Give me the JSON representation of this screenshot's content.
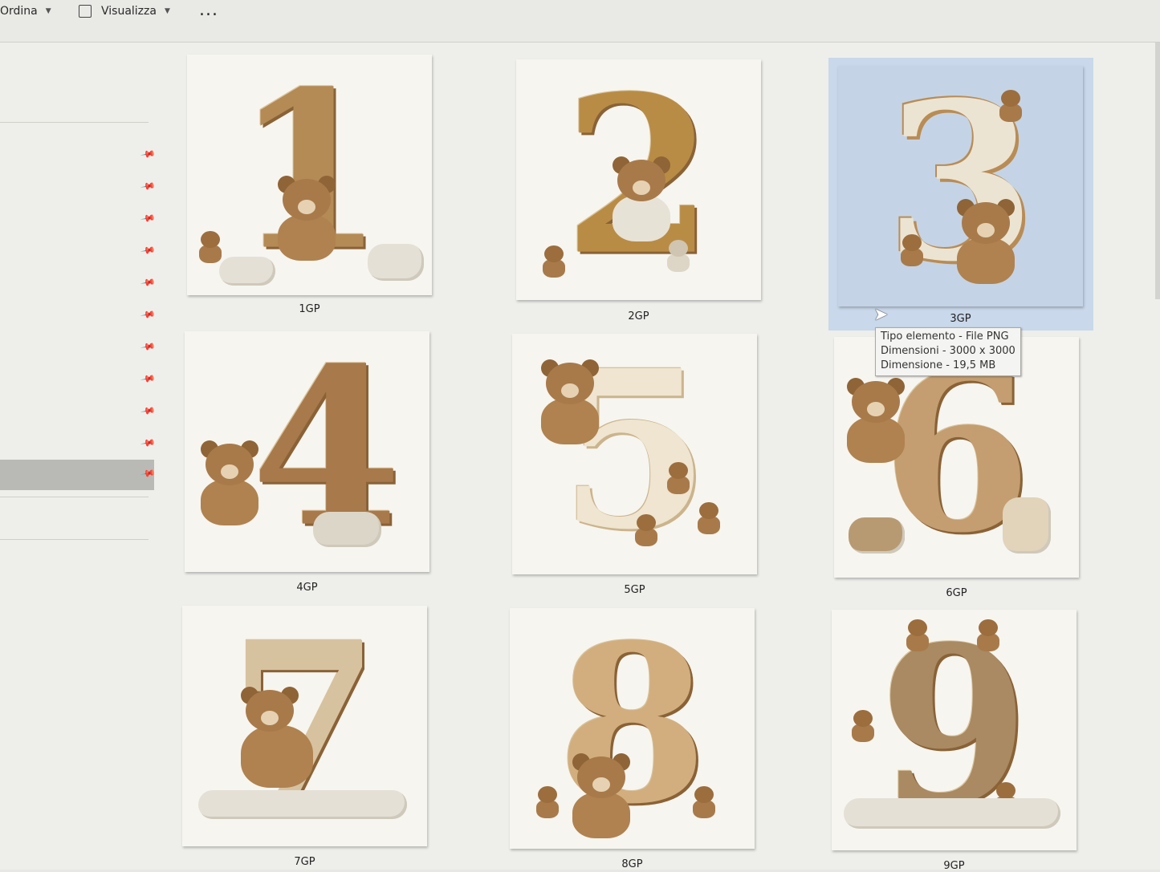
{
  "toolbar": {
    "sort_label": "Ordina",
    "view_label": "Visualizza",
    "more_label": "..."
  },
  "files": [
    {
      "name": "1GP",
      "digit": "1"
    },
    {
      "name": "2GP",
      "digit": "2"
    },
    {
      "name": "3GP",
      "digit": "3"
    },
    {
      "name": "4GP",
      "digit": "4"
    },
    {
      "name": "5GP",
      "digit": "5"
    },
    {
      "name": "6GP",
      "digit": "6"
    },
    {
      "name": "7GP",
      "digit": "7"
    },
    {
      "name": "8GP",
      "digit": "8"
    },
    {
      "name": "9GP",
      "digit": "9"
    }
  ],
  "selected_file": "3GP",
  "tooltip": {
    "line1": "Tipo elemento - File PNG",
    "line2": "Dimensioni - 3000 x 3000",
    "line3": "Dimensione - 19,5 MB"
  },
  "colors": {
    "selection": "#c9d8ea",
    "thumbnail_bg": "#f6f5f0",
    "digit": "#b48a55"
  }
}
